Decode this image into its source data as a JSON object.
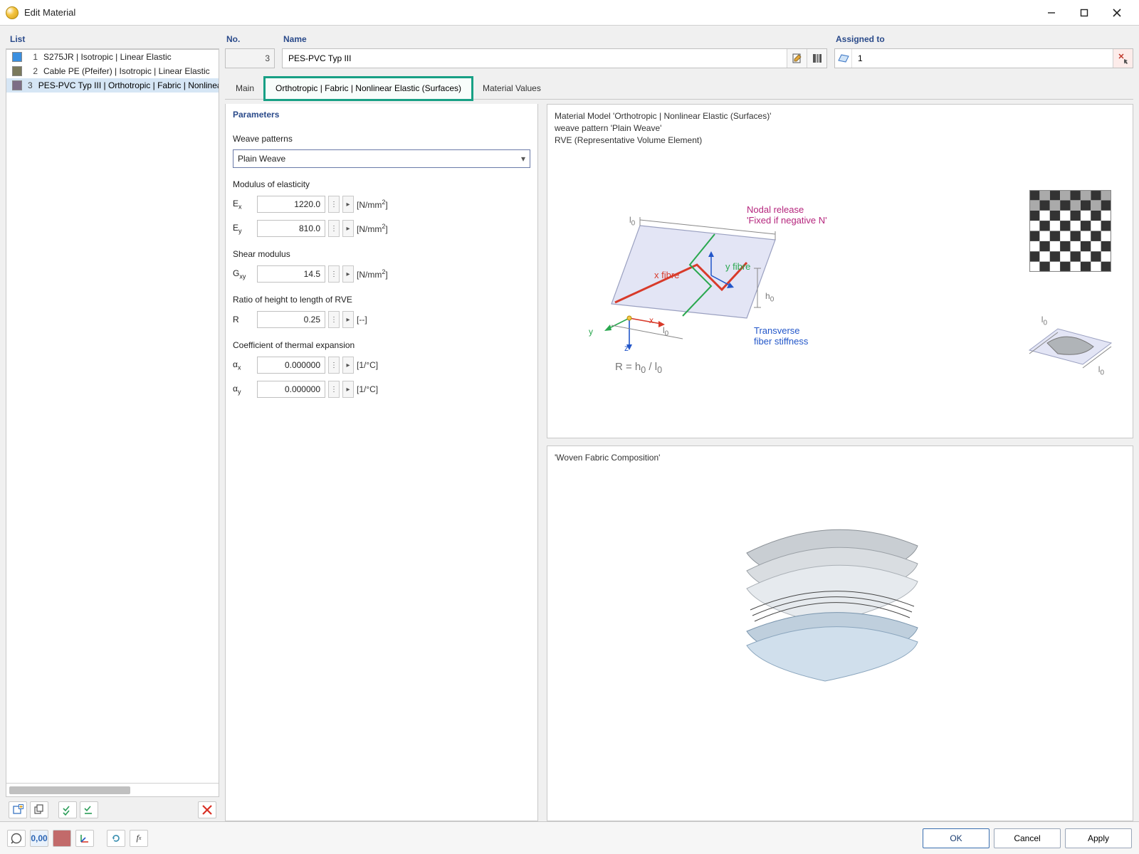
{
  "window": {
    "title": "Edit Material"
  },
  "list": {
    "header": "List",
    "items": [
      {
        "num": "1",
        "color": "#3a8fe0",
        "label": "S275JR | Isotropic | Linear Elastic",
        "selected": false
      },
      {
        "num": "2",
        "color": "#7a795c",
        "label": "Cable PE (Pfeifer) | Isotropic | Linear Elastic",
        "selected": false
      },
      {
        "num": "3",
        "color": "#7d6d85",
        "label": "PES-PVC Typ III | Orthotropic | Fabric | Nonlinear Elastic (Surfaces)",
        "selected": true
      }
    ],
    "toolbar": {
      "new": "new",
      "copy": "copy",
      "check1": "check",
      "check2": "check",
      "delete": "delete"
    }
  },
  "fields": {
    "no_label": "No.",
    "no_value": "3",
    "name_label": "Name",
    "name_value": "PES-PVC Typ III",
    "assigned_label": "Assigned to",
    "assigned_value": "1"
  },
  "tabs": {
    "main": "Main",
    "ortho": "Orthotropic | Fabric | Nonlinear Elastic (Surfaces)",
    "values": "Material Values"
  },
  "params": {
    "header": "Parameters",
    "weave_label": "Weave patterns",
    "weave_value": "Plain Weave",
    "modulus_label": "Modulus of elasticity",
    "Ex_sym": "E",
    "Ex_sub": "x",
    "Ex_val": "1220.0",
    "Ex_unit": "[N/mm",
    "Ex_sup": "2",
    "Ex_unit_end": "]",
    "Ey_sym": "E",
    "Ey_sub": "y",
    "Ey_val": "810.0",
    "Ey_unit": "[N/mm",
    "Ey_sup": "2",
    "Ey_unit_end": "]",
    "shear_label": "Shear modulus",
    "Gxy_sym": "G",
    "Gxy_sub": "xy",
    "Gxy_val": "14.5",
    "Gxy_unit": "[N/mm",
    "Gxy_sup": "2",
    "Gxy_unit_end": "]",
    "ratio_label": "Ratio of height to length of RVE",
    "R_sym": "R",
    "R_val": "0.25",
    "R_unit": "[--]",
    "cte_label": "Coefficient of thermal expansion",
    "ax_sym": "α",
    "ax_sub": "x",
    "ax_val": "0.000000",
    "ax_unit": "[1/°C]",
    "ay_sym": "α",
    "ay_sub": "y",
    "ay_val": "0.000000",
    "ay_unit": "[1/°C]"
  },
  "vis1": {
    "line1": "Material Model 'Orthotropic | Nonlinear Elastic (Surfaces)'",
    "line2": "weave pattern 'Plain Weave'",
    "line3": "RVE (Representative Volume Element)",
    "nodal": "Nodal release",
    "nodal2": "'Fixed if negative N'",
    "yfibre": "y fibre",
    "xfibre": "x fibre",
    "trans1": "Transverse",
    "trans2": "fiber stiffness",
    "R_eq": "R = h",
    "R_eq_sub": "0",
    "R_eq_mid": " / l",
    "R_eq_sub2": "0",
    "h0": "h",
    "l0": "l",
    "axis_x": "x",
    "axis_y": "y",
    "axis_z": "z"
  },
  "vis2": {
    "title": "'Woven Fabric Composition'"
  },
  "buttons": {
    "ok": "OK",
    "cancel": "Cancel",
    "apply": "Apply"
  }
}
